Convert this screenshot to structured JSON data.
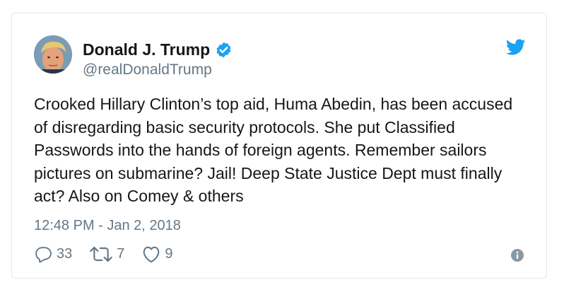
{
  "tweet": {
    "author_name": "Donald J. Trump",
    "author_handle": "@realDonaldTrump",
    "verified": true,
    "text": "Crooked Hillary Clinton’s top aid, Huma Abedin, has been accused of disregarding basic security protocols. She put Classified Passwords into the hands of foreign agents. Remember sailors pictures on submarine? Jail! Deep State Justice Dept must finally act? Also on Comey & others",
    "timestamp": "12:48 PM - Jan 2, 2018"
  },
  "actions": {
    "replies": "33",
    "retweets": "7",
    "likes": "9"
  },
  "icons": {
    "brand": "twitter-bird-icon",
    "verified": "verified-badge-icon",
    "reply": "reply-icon",
    "retweet": "retweet-icon",
    "like": "heart-icon",
    "info": "info-icon"
  },
  "colors": {
    "brand_blue": "#1da1f2",
    "text": "#14171a",
    "muted": "#657786",
    "border": "#e1e8ed"
  }
}
